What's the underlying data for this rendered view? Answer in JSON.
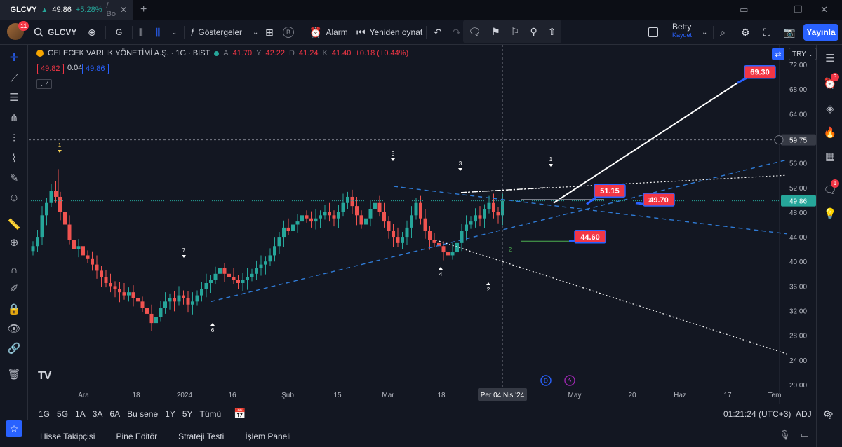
{
  "browser": {
    "tab_symbol": "GLCVY",
    "tab_price": "49.86",
    "tab_change": "+5.28%",
    "tab_rest": "/ Bo",
    "close_icon": "close-icon",
    "new_tab": "+"
  },
  "toolbar": {
    "notifications": "11",
    "symbol": "GLCVY",
    "interval": "G",
    "indicators": "Göstergeler",
    "alert": "Alarm",
    "replay": "Yeniden oynat",
    "layout_name": "Betty",
    "layout_sub": "Kaydet",
    "publish": "Yayınla"
  },
  "legend": {
    "title": "GELECEK VARLIK YÖNETİMİ A.Ş. · 1G · BIST",
    "o_label": "A",
    "o_value": "41.70",
    "h_label": "Y",
    "h_value": "42.22",
    "l_label": "D",
    "l_value": "41.24",
    "c_label": "K",
    "c_value": "41.40",
    "change": "+0.18 (+0.44%)",
    "sell_price": "49.82",
    "spread": "0.04",
    "buy_price": "49.86",
    "indicator_count": "4",
    "currency": "TRY"
  },
  "chart_data": {
    "type": "candlestick",
    "symbol": "GLCVY",
    "exchange": "BIST",
    "interval": "1G",
    "y_ticks": [
      "72.00",
      "68.00",
      "64.00",
      "60.00",
      "56.00",
      "52.00",
      "48.00",
      "44.00",
      "40.00",
      "36.00",
      "32.00",
      "28.00",
      "24.00",
      "20.00"
    ],
    "ylim": [
      20,
      72
    ],
    "x_ticks": [
      "Ara",
      "18",
      "2024",
      "16",
      "Şub",
      "15",
      "Mar",
      "18",
      "May",
      "20",
      "Haz",
      "17",
      "Tem"
    ],
    "crosshair_date": "Per 04 Nis '24",
    "crosshair_price": "59.75",
    "last_price": "49.86",
    "targets": [
      {
        "label": "69.30",
        "price": 69.3
      },
      {
        "label": "51.15",
        "price": 51.15
      },
      {
        "label": "49.70",
        "price": 49.7
      },
      {
        "label": "44.60",
        "price": 44.6
      }
    ],
    "wave_labels": [
      "1",
      "7",
      "6",
      "5",
      "3",
      "4",
      "2",
      "1",
      "1",
      "2"
    ],
    "event_markers": [
      "D",
      "ϟ"
    ],
    "closes": [
      42.5,
      44.0,
      47.5,
      49.5,
      51.5,
      50.5,
      48.0,
      46.0,
      43.5,
      42.0,
      42.5,
      41.0,
      40.5,
      39.5,
      38.5,
      37.5,
      36.5,
      36.0,
      35.5,
      35.0,
      34.5,
      35.0,
      34.0,
      33.5,
      32.5,
      31.5,
      30.0,
      31.0,
      32.5,
      33.5,
      34.0,
      33.5,
      34.5,
      34.0,
      33.0,
      33.5,
      34.5,
      35.5,
      36.5,
      37.0,
      38.0,
      39.0,
      38.0,
      37.5,
      37.0,
      36.5,
      37.0,
      37.5,
      38.0,
      39.0,
      39.5,
      40.0,
      41.0,
      42.5,
      44.0,
      45.5,
      45.0,
      46.0,
      46.5,
      47.5,
      47.0,
      46.5,
      47.0,
      47.5,
      48.0,
      47.5,
      47.0,
      48.0,
      49.5,
      50.5,
      49.0,
      47.5,
      46.0,
      47.0,
      48.5,
      49.5,
      48.0,
      46.5,
      45.0,
      44.0,
      43.0,
      44.0,
      45.5,
      47.5,
      49.5,
      47.0,
      45.0,
      43.5,
      43.0,
      42.5,
      41.5,
      41.0,
      41.5,
      43.0,
      45.0,
      46.0,
      46.5,
      47.5,
      47.0,
      48.5,
      49.5,
      48.0,
      47.5,
      49.86
    ]
  },
  "range_bar": {
    "ranges": [
      "1G",
      "5G",
      "1A",
      "3A",
      "6A",
      "Bu sene",
      "1Y",
      "5Y",
      "Tümü"
    ],
    "time": "01:21:24 (UTC+3)",
    "adj": "ADJ"
  },
  "bottom_panel": {
    "tabs": [
      "Hisse Takipçisi",
      "Pine Editör",
      "Strateji Testi",
      "İşlem Paneli"
    ]
  }
}
